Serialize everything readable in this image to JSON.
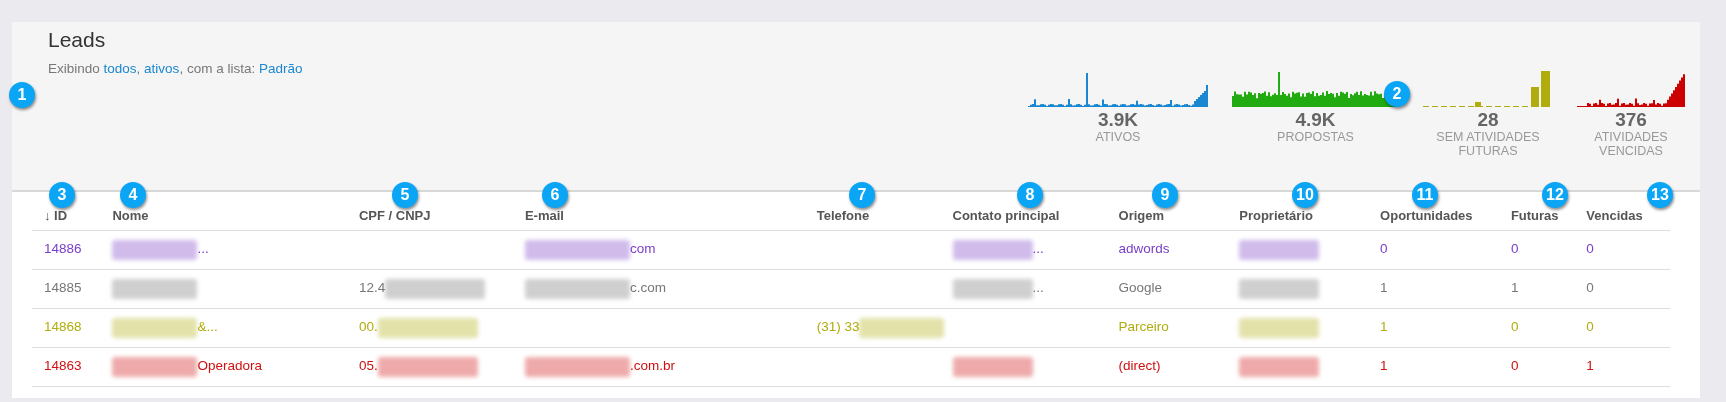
{
  "page": {
    "title": "Leads",
    "summary": [
      {
        "text": "Exibindo "
      },
      {
        "text": "todos",
        "link": true
      },
      {
        "text": ", "
      },
      {
        "text": "ativos",
        "link": true
      },
      {
        "text": ", com a lista: "
      },
      {
        "text": "Padrão",
        "link": true
      }
    ]
  },
  "stats": [
    {
      "value": "3.9K",
      "label": "ATIVOS",
      "color": "#1a87d0",
      "kind": "area"
    },
    {
      "value": "4.9K",
      "label": "PROPOSTAS",
      "color": "#22aa11",
      "kind": "area"
    },
    {
      "value": "28",
      "label": "SEM ATIVIDADES FUTURAS",
      "color": "#b0ac0e",
      "kind": "dashed"
    },
    {
      "value": "376",
      "label": "ATIVIDADES VENCIDAS",
      "color": "#cc0000",
      "kind": "area"
    }
  ],
  "table": {
    "columns": [
      {
        "label": "ID",
        "sort_icon": "↓"
      },
      {
        "label": "Nome"
      },
      {
        "label": "CPF / CNPJ"
      },
      {
        "label": "E-mail"
      },
      {
        "label": "Telefone"
      },
      {
        "label": "Contato principal"
      },
      {
        "label": "Origem"
      },
      {
        "label": "Proprietário"
      },
      {
        "label": "Oportunidades"
      },
      {
        "label": "Futuras"
      },
      {
        "label": "Vencidas"
      }
    ],
    "rows": [
      {
        "color": "#7a3fc8",
        "cells": [
          {
            "text": "14886"
          },
          {
            "text": "...",
            "blurred_before": true
          },
          {},
          {
            "text": "com",
            "blurred_before": true
          },
          {},
          {
            "text": "...",
            "blurred_before": true
          },
          {
            "text": "adwords"
          },
          {
            "blurred": true
          },
          {
            "text": "0"
          },
          {
            "text": "0"
          },
          {
            "text": "0"
          }
        ]
      },
      {
        "color": "#777777",
        "cells": [
          {
            "text": "14885"
          },
          {
            "blurred": true
          },
          {
            "text": "12.4",
            "blurred_after": true
          },
          {
            "text": "c.com",
            "blurred_before": true
          },
          {},
          {
            "text": "...",
            "blurred_before": true
          },
          {
            "text": "Google"
          },
          {
            "blurred": true
          },
          {
            "text": "1"
          },
          {
            "text": "1"
          },
          {
            "text": "0"
          }
        ]
      },
      {
        "color": "#b0ac0e",
        "cells": [
          {
            "text": "14868"
          },
          {
            "text": "&...",
            "blurred_before": true
          },
          {
            "text": "00.",
            "blurred_after": true
          },
          {},
          {
            "text": "(31) 33",
            "blurred_after": true
          },
          {},
          {
            "text": "Parceiro"
          },
          {
            "blurred": true
          },
          {
            "text": "1"
          },
          {
            "text": "0"
          },
          {
            "text": "0"
          }
        ]
      },
      {
        "color": "#d01010",
        "cells": [
          {
            "text": "14863"
          },
          {
            "text": "Operadora",
            "blurred_before": true
          },
          {
            "text": "05.",
            "blurred_after": true
          },
          {
            "text": ".com.br",
            "blurred_before": true
          },
          {},
          {
            "blurred": true
          },
          {
            "text": "(direct)"
          },
          {
            "blurred": true
          },
          {
            "text": "1"
          },
          {
            "text": "0"
          },
          {
            "text": "1"
          }
        ]
      }
    ]
  },
  "callouts": [
    {
      "number": "1"
    },
    {
      "number": "2"
    },
    {
      "number": "3"
    },
    {
      "number": "4"
    },
    {
      "number": "5"
    },
    {
      "number": "6"
    },
    {
      "number": "7"
    },
    {
      "number": "8"
    },
    {
      "number": "9"
    },
    {
      "number": "10"
    },
    {
      "number": "11"
    },
    {
      "number": "12"
    },
    {
      "number": "13"
    }
  ]
}
